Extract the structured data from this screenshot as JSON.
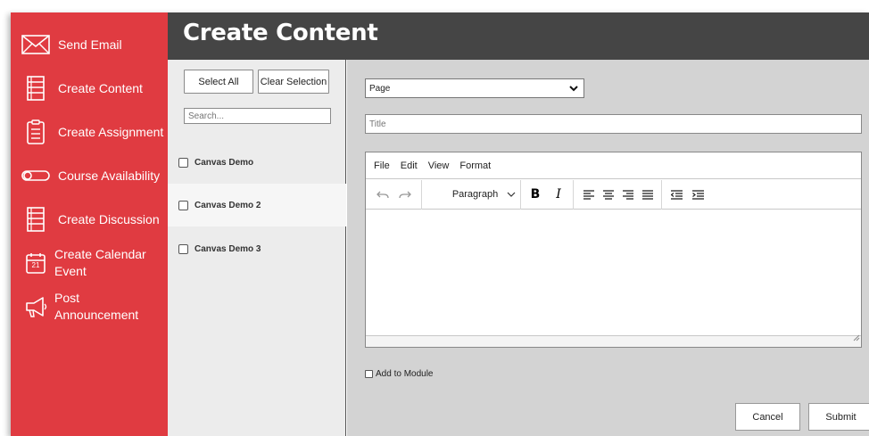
{
  "sidebar": {
    "items": [
      {
        "label": "Send Email",
        "icon": "envelope-icon"
      },
      {
        "label": "Create Content",
        "icon": "document-icon"
      },
      {
        "label": "Create Assignment",
        "icon": "clipboard-icon"
      },
      {
        "label": "Course Availability",
        "icon": "toggle-icon"
      },
      {
        "label": "Create Discussion",
        "icon": "document-icon"
      },
      {
        "label": "Create Calendar Event",
        "icon": "calendar-icon",
        "calendar_day": "21"
      },
      {
        "label": "Post Announcement",
        "icon": "megaphone-icon"
      }
    ]
  },
  "header": {
    "title": "Create Content"
  },
  "courses": {
    "select_all_label": "Select All",
    "clear_selection_label": "Clear Selection",
    "search_placeholder": "Search...",
    "items": [
      {
        "name": "Canvas Demo",
        "checked": false
      },
      {
        "name": "Canvas Demo 2",
        "checked": false
      },
      {
        "name": "Canvas Demo 3",
        "checked": false
      }
    ]
  },
  "form": {
    "content_type_selected": "Page",
    "title_placeholder": "Title",
    "editor": {
      "menu": [
        "File",
        "Edit",
        "View",
        "Format"
      ],
      "block_format": "Paragraph"
    },
    "add_to_module_label": "Add to Module",
    "cancel_label": "Cancel",
    "submit_label": "Submit"
  },
  "colors": {
    "sidebar_red": "#e03b41",
    "header_gray": "#454545",
    "main_gray": "#d3d3d3",
    "panel_gray": "#ececec"
  }
}
